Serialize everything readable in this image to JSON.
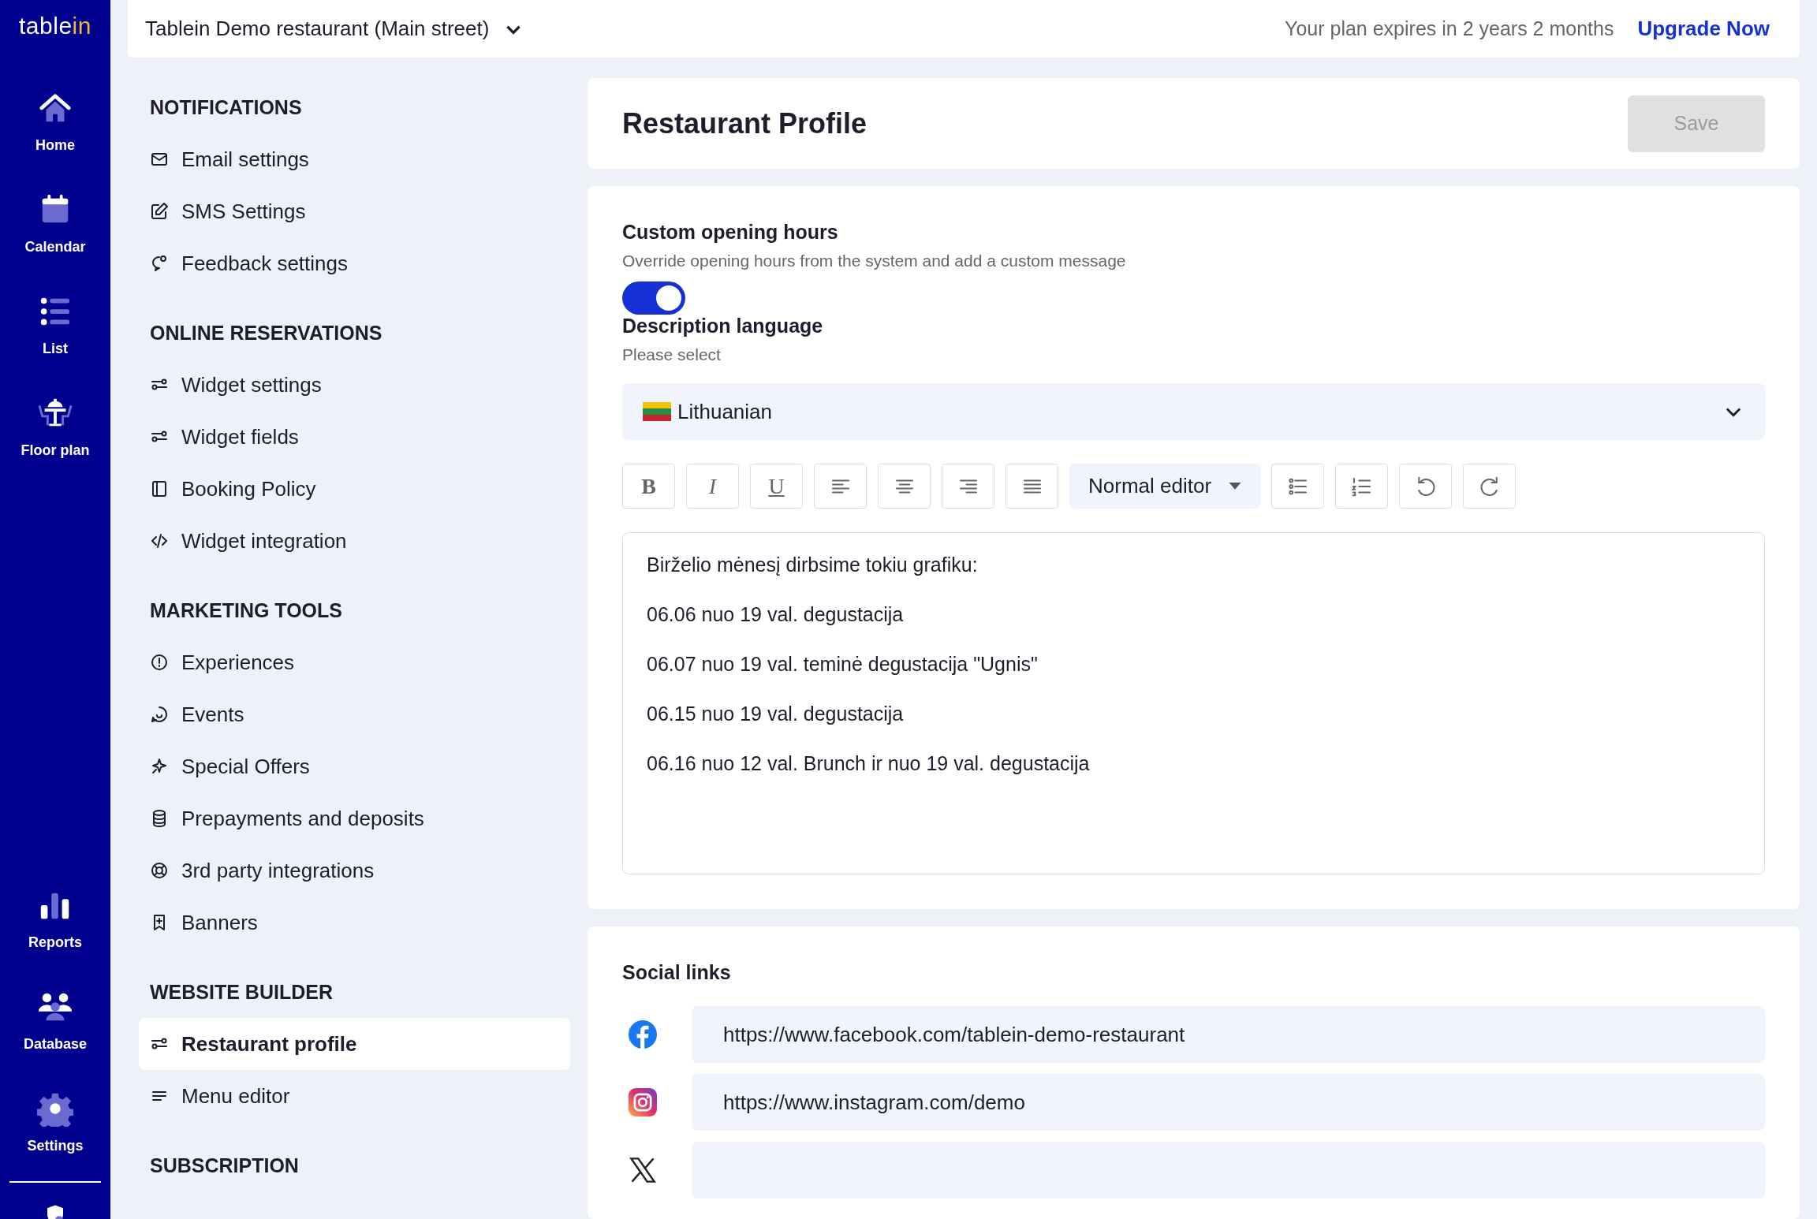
{
  "logo": {
    "text": "table",
    "accent": "in"
  },
  "nav": [
    {
      "label": "Home",
      "kind": "home"
    },
    {
      "label": "Calendar",
      "kind": "calendar"
    },
    {
      "label": "List",
      "kind": "list"
    },
    {
      "label": "Floor plan",
      "kind": "floor"
    }
  ],
  "nav_bottom": [
    {
      "label": "Reports",
      "kind": "reports"
    },
    {
      "label": "Database",
      "kind": "database"
    },
    {
      "label": "Settings",
      "kind": "settings"
    }
  ],
  "top_bar": {
    "restaurant": "Tablein Demo restaurant (Main street)",
    "plan_notice": "Your plan expires in 2 years 2 months",
    "upgrade_link": "Upgrade Now"
  },
  "sidebar": [
    {
      "heading": "NOTIFICATIONS",
      "items": [
        {
          "label": "Email settings",
          "kind": "mail",
          "selected": false
        },
        {
          "label": "SMS Settings",
          "kind": "edit",
          "selected": false
        },
        {
          "label": "Feedback settings",
          "kind": "chat",
          "selected": false
        }
      ]
    },
    {
      "heading": "ONLINE RESERVATIONS",
      "items": [
        {
          "label": "Widget settings",
          "kind": "sliders",
          "selected": false
        },
        {
          "label": "Widget fields",
          "kind": "sliders",
          "selected": false
        },
        {
          "label": "Booking Policy",
          "kind": "panel",
          "selected": false
        },
        {
          "label": "Widget integration",
          "kind": "code",
          "selected": false
        }
      ]
    },
    {
      "heading": "MARKETING TOOLS",
      "items": [
        {
          "label": "Experiences",
          "kind": "alert",
          "selected": false
        },
        {
          "label": "Events",
          "kind": "smile",
          "selected": false
        },
        {
          "label": "Special Offers",
          "kind": "sparkle",
          "selected": false
        },
        {
          "label": "Prepayments and deposits",
          "kind": "coins",
          "selected": false
        },
        {
          "label": "3rd party integrations",
          "kind": "lifebuoy",
          "selected": false
        },
        {
          "label": "Banners",
          "kind": "bookmark",
          "selected": false
        }
      ]
    },
    {
      "heading": "WEBSITE BUILDER",
      "items": [
        {
          "label": "Restaurant profile",
          "kind": "sliders",
          "selected": true
        },
        {
          "label": "Menu editor",
          "kind": "menu",
          "selected": false
        }
      ]
    },
    {
      "heading": "SUBSCRIPTION"
    }
  ],
  "page": {
    "title": "Restaurant Profile",
    "save_button": {
      "label": "Save",
      "disabled": true
    }
  },
  "opening_hours": {
    "title": "Custom opening hours",
    "subtitle": "Override opening hours from the system and add a custom message",
    "on": true
  },
  "description_language": {
    "title": "Description language",
    "subtitle": "Please select",
    "value": "Lithuanian"
  },
  "toolbar": [
    {
      "kind": "bold",
      "label": "B"
    },
    {
      "kind": "italic",
      "label": "I"
    },
    {
      "kind": "underline",
      "label": "U"
    },
    {
      "kind": "align-left"
    },
    {
      "kind": "align-center"
    },
    {
      "kind": "align-right"
    },
    {
      "kind": "justify"
    },
    {
      "kind": "dropdown",
      "label": "Normal editor"
    },
    {
      "kind": "bullets"
    },
    {
      "kind": "numbers"
    },
    {
      "kind": "undo"
    },
    {
      "kind": "redo"
    }
  ],
  "editor_paragraphs": [
    "Birželio mėnesį dirbsime tokiu grafiku:",
    "06.06 nuo 19 val. degustacija",
    "06.07 nuo 19 val. teminė degustacija \"Ugnis\"",
    "06.15 nuo 19 val. degustacija",
    "06.16 nuo 12 val. Brunch ir nuo 19 val. degustacija"
  ],
  "social_links": {
    "title": "Social links",
    "items": [
      {
        "kind": "facebook",
        "value": "https://www.facebook.com/tablein-demo-restaurant"
      },
      {
        "kind": "instagram",
        "value": "https://www.instagram.com/demo"
      },
      {
        "kind": "x",
        "value": ""
      }
    ]
  }
}
